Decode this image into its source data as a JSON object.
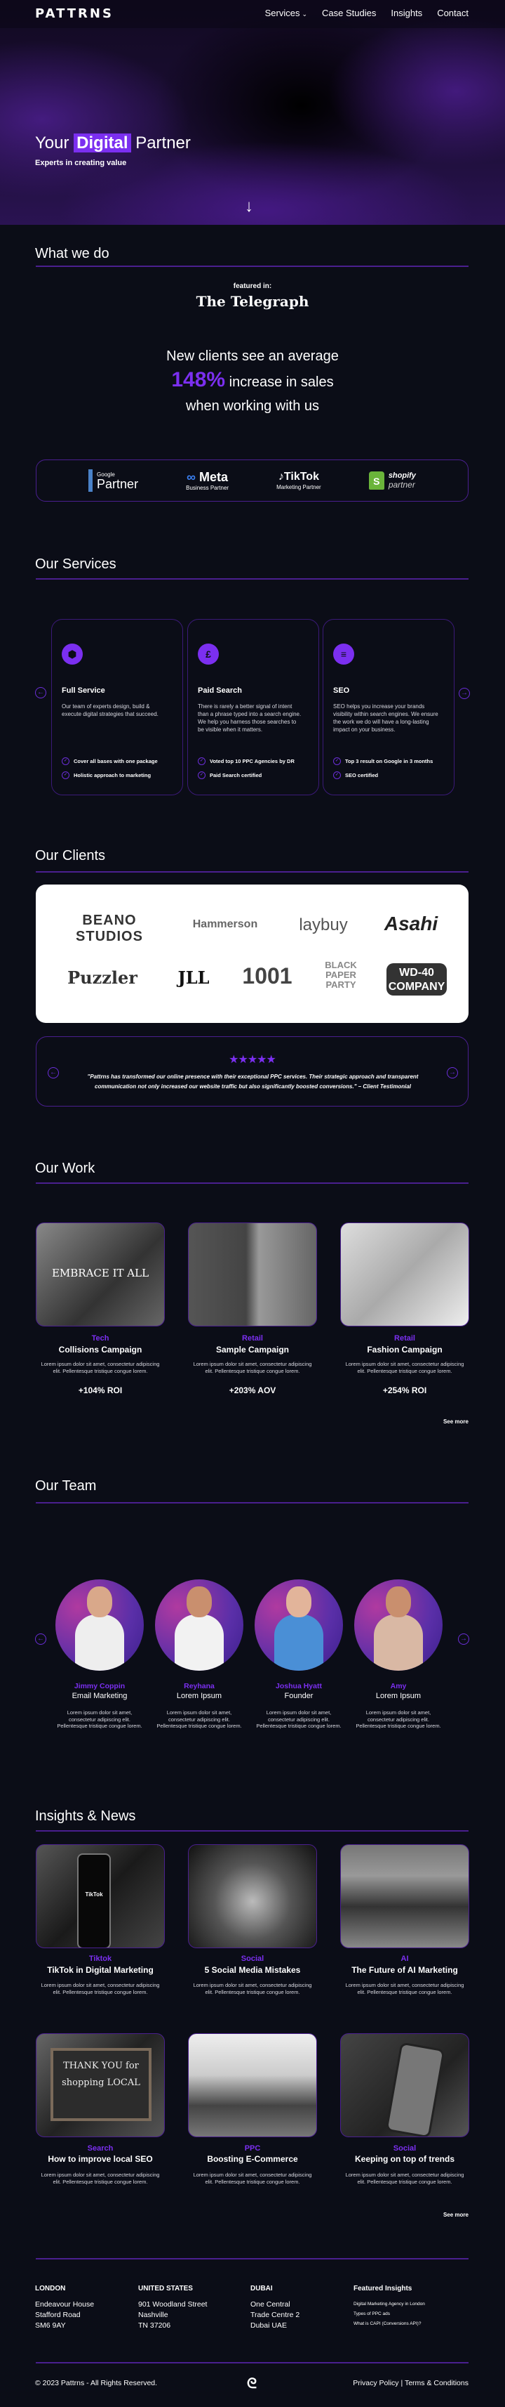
{
  "nav": {
    "logo": "PATTRNS",
    "links": [
      "Services",
      "Case Studies",
      "Insights",
      "Contact"
    ],
    "services_chevron": "⌄"
  },
  "hero": {
    "title_before": "Your",
    "title_highlight": "Digital",
    "title_after": "Partner",
    "subtitle": "Experts in creating value",
    "down_icon": "↓"
  },
  "what_we_do": {
    "heading": "What we do",
    "featured_label": "featured in:",
    "featured_outlet": "The Telegraph",
    "stat_line1": "New clients see an average",
    "stat_value": "148%",
    "stat_line2": "increase in sales",
    "stat_line3": "when working with us",
    "partners": [
      {
        "brand": "Google",
        "label": "Partner"
      },
      {
        "brand": "Meta",
        "label": "Business Partner"
      },
      {
        "brand": "TikTok",
        "label": "Marketing Partner"
      },
      {
        "brand": "shopify",
        "label": "partner"
      }
    ]
  },
  "services": {
    "heading": "Our Services",
    "items": [
      {
        "icon": "⬢",
        "title": "Full Service",
        "desc": "Our team of experts design, build & execute digital strategies that succeed.",
        "features": [
          "Cover all bases with one package",
          "Holistic approach to marketing"
        ]
      },
      {
        "icon": "£",
        "title": "Paid Search",
        "desc": "There is rarely a better signal of intent than a phrase typed into a search engine. We help you harness those searches to be visible when it matters.",
        "features": [
          "Voted top 10 PPC Agencies by DR",
          "Paid Search certified"
        ]
      },
      {
        "icon": "≡",
        "title": "SEO",
        "desc": "SEO helps you increase your brands visibility within search engines. We ensure the work we do will have a long-lasting impact on your business.",
        "features": [
          "Top 3 result on Google in 3 months",
          "SEO certified"
        ]
      }
    ]
  },
  "clients": {
    "heading": "Our Clients",
    "logos": [
      "BEANO STUDIOS",
      "Hammerson",
      "laybuy",
      "Asahi",
      "Puzzler",
      "JLL",
      "1001",
      "BLACK PAPER PARTY",
      "WD-40 COMPANY"
    ],
    "rating": "★★★★★",
    "testimonial": "\"Pattrns has transformed our online presence with their exceptional PPC services. Their strategic approach and transparent communication not only increased our website traffic but also significantly boosted conversions.\" – Client Testimonial"
  },
  "work": {
    "heading": "Our Work",
    "items": [
      {
        "category": "Tech",
        "title": "Collisions Campaign",
        "desc": "Lorem ipsum dolor sit amet, consectetur adipiscing elit. Pellentesque tristique congue lorem.",
        "stat": "+104% ROI",
        "image_text": "EMBRACE IT ALL"
      },
      {
        "category": "Retail",
        "title": "Sample Campaign",
        "desc": "Lorem ipsum dolor sit amet, consectetur adipiscing elit. Pellentesque tristique congue lorem.",
        "stat": "+203% AOV"
      },
      {
        "category": "Retail",
        "title": "Fashion Campaign",
        "desc": "Lorem ipsum dolor sit amet, consectetur adipiscing elit. Pellentesque tristique congue lorem.",
        "stat": "+254% ROI"
      }
    ],
    "see_more": "See more"
  },
  "team": {
    "heading": "Our Team",
    "members": [
      {
        "name": "Jimmy Coppin",
        "role": "Email Marketing",
        "desc": "Lorem ipsum dolor sit amet, consectetur adipiscing elit. Pellentesque tristique congue lorem."
      },
      {
        "name": "Reyhana",
        "role": "Lorem Ipsum",
        "desc": "Lorem ipsum dolor sit amet, consectetur adipiscing elit. Pellentesque tristique congue lorem."
      },
      {
        "name": "Joshua Hyatt",
        "role": "Founder",
        "desc": "Lorem ipsum dolor sit amet, consectetur adipiscing elit. Pellentesque tristique congue lorem."
      },
      {
        "name": "Amy",
        "role": "Lorem Ipsum",
        "desc": "Lorem ipsum dolor sit amet, consectetur adipiscing elit. Pellentesque tristique congue lorem."
      }
    ]
  },
  "insights": {
    "heading": "Insights & News",
    "items": [
      {
        "category": "Tiktok",
        "title": "TikTok in Digital Marketing",
        "desc": "Lorem ipsum dolor sit amet, consectetur adipiscing elit. Pellentesque tristique congue lorem.",
        "image_text": "TikTok"
      },
      {
        "category": "Social",
        "title": "5 Social Media Mistakes",
        "desc": "Lorem ipsum dolor sit amet, consectetur adipiscing elit. Pellentesque tristique congue lorem."
      },
      {
        "category": "AI",
        "title": "The Future of AI Marketing",
        "desc": "Lorem ipsum dolor sit amet, consectetur adipiscing elit. Pellentesque tristique congue lorem."
      },
      {
        "category": "Search",
        "title": "How to improve local SEO",
        "desc": "Lorem ipsum dolor sit amet, consectetur adipiscing elit. Pellentesque tristique congue lorem.",
        "image_text": "THANK YOU for shopping LOCAL"
      },
      {
        "category": "PPC",
        "title": "Boosting E-Commerce",
        "desc": "Lorem ipsum dolor sit amet, consectetur adipiscing elit. Pellentesque tristique congue lorem."
      },
      {
        "category": "Social",
        "title": "Keeping on top of trends",
        "desc": "Lorem ipsum dolor sit amet, consectetur adipiscing elit. Pellentesque tristique congue lorem."
      }
    ],
    "see_more": "See more"
  },
  "footer": {
    "offices": [
      {
        "city": "LONDON",
        "lines": [
          "Endeavour House",
          "Stafford Road",
          "SM6 9AY"
        ]
      },
      {
        "city": "UNITED STATES",
        "lines": [
          "901 Woodland Street",
          "Nashville",
          "TN 37206"
        ]
      },
      {
        "city": "DUBAI",
        "lines": [
          "One Central",
          "Trade Centre 2",
          "Dubai UAE"
        ]
      }
    ],
    "featured_heading": "Featured Insights",
    "featured_links": [
      "Digital Marketing Agency in London",
      "Types of PPC ads",
      "What is CAPI (Conversions API)?"
    ],
    "copyright": "© 2023 Pattrns - All Rights Reserved.",
    "privacy": "Privacy Policy",
    "separator": "|",
    "terms": "Terms & Conditions",
    "logo_glyph": "ᘓ"
  },
  "colors": {
    "accent": "#7b2ff0",
    "divider": "#4a1f8f",
    "background": "#0b0d17"
  }
}
